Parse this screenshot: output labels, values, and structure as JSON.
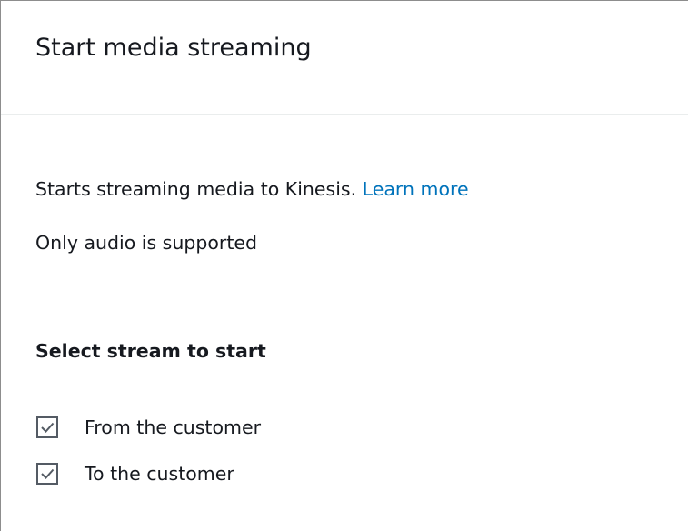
{
  "panel": {
    "title": "Start media streaming",
    "description": "Starts streaming media to Kinesis.",
    "learn_more_link": "Learn more",
    "note": "Only audio is supported"
  },
  "stream_selection": {
    "label": "Select stream to start",
    "options": [
      {
        "label": "From the customer",
        "checked": true
      },
      {
        "label": "To the customer",
        "checked": true
      }
    ]
  },
  "colors": {
    "link": "#0073bb",
    "text": "#16191f",
    "checkbox_stroke": "#545b64"
  },
  "icons": {
    "checkbox": "checkbox-checked-icon"
  }
}
